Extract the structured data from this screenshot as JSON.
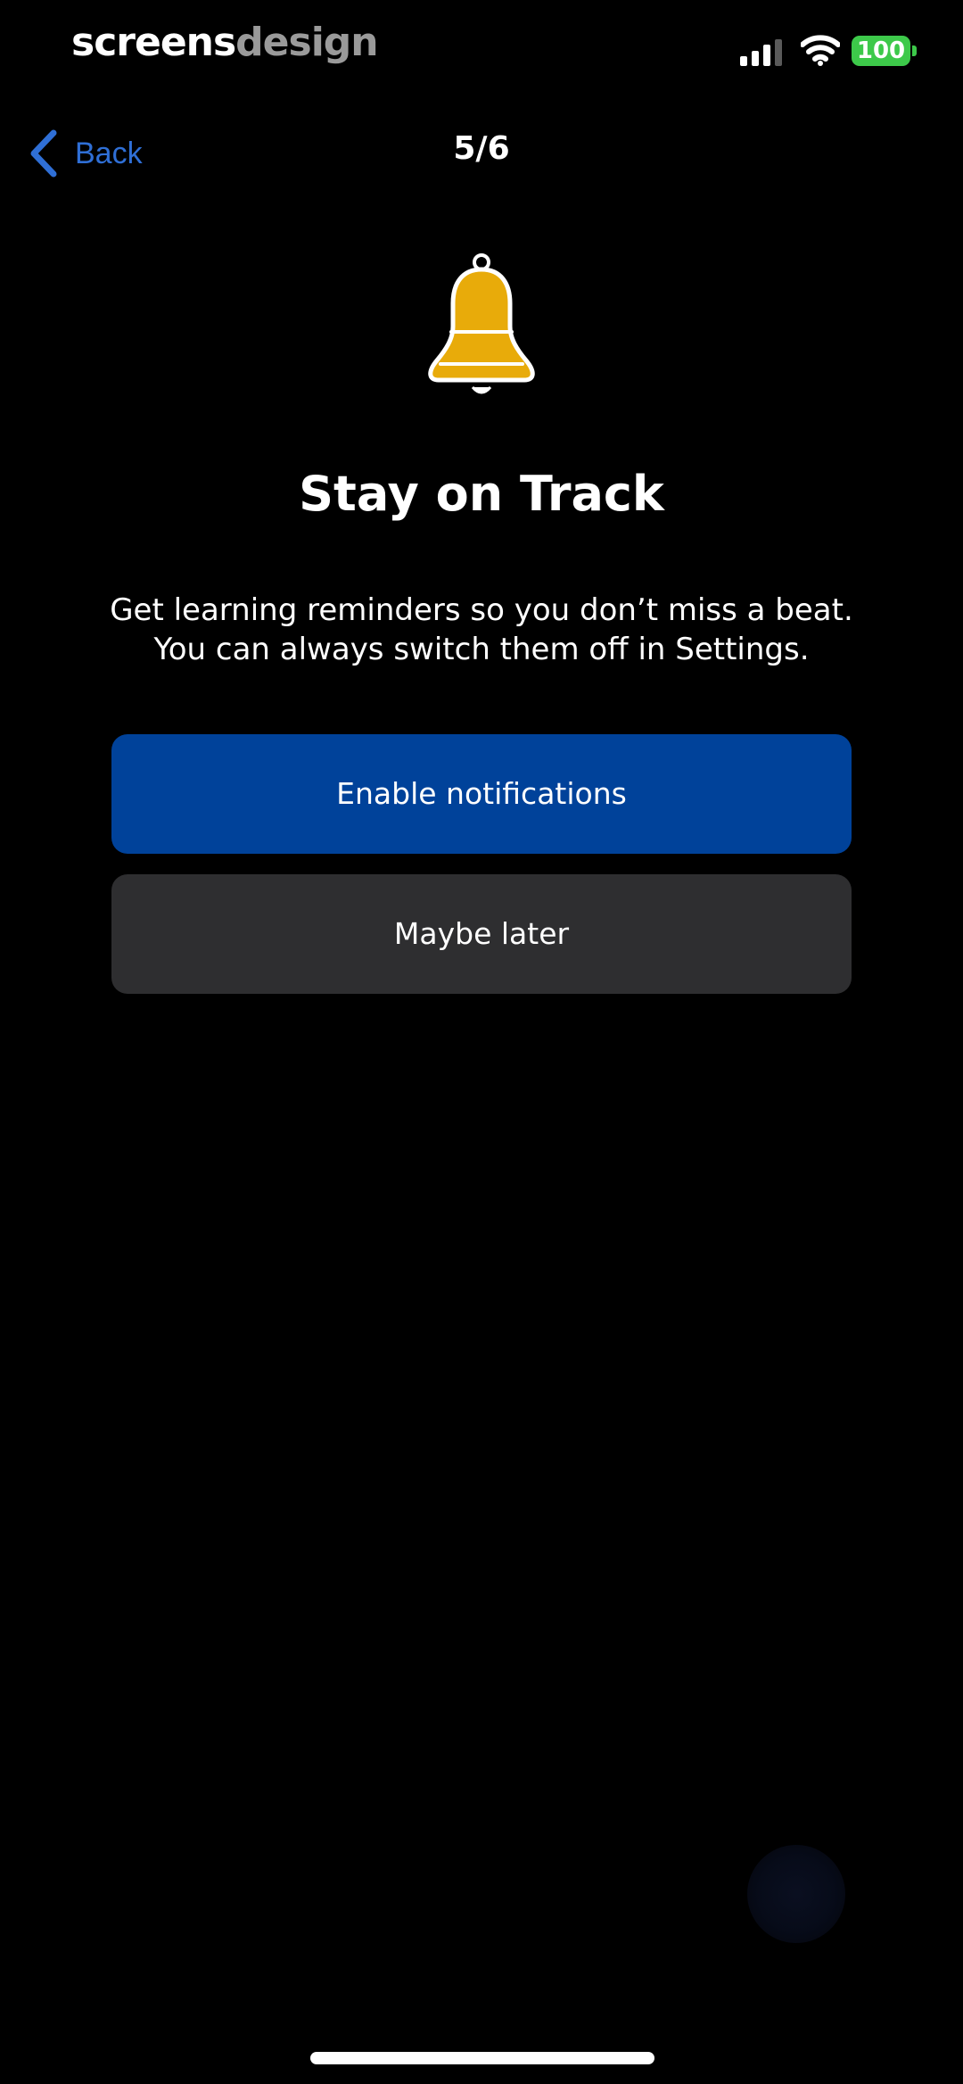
{
  "status_bar": {
    "watermark_part1": "screens",
    "watermark_part2": "design",
    "battery_level": "100",
    "signal_icon": "cellular-signal-icon",
    "wifi_icon": "wifi-icon",
    "battery_color": "#3dc94a"
  },
  "nav": {
    "back_label": "Back",
    "step": "5/6"
  },
  "content": {
    "icon": "bell-icon",
    "icon_color": "#e8ab0a",
    "title": "Stay on Track",
    "description_line1": "Get learning reminders so you don’t miss a beat.",
    "description_line2": "You can always switch them off in Settings."
  },
  "actions": {
    "enable_label": "Enable notifications",
    "later_label": "Maybe later",
    "primary_color": "#00429a",
    "secondary_color": "#2e2e30"
  },
  "theme": {
    "accent": "#2f6fd6",
    "background": "#000000"
  }
}
